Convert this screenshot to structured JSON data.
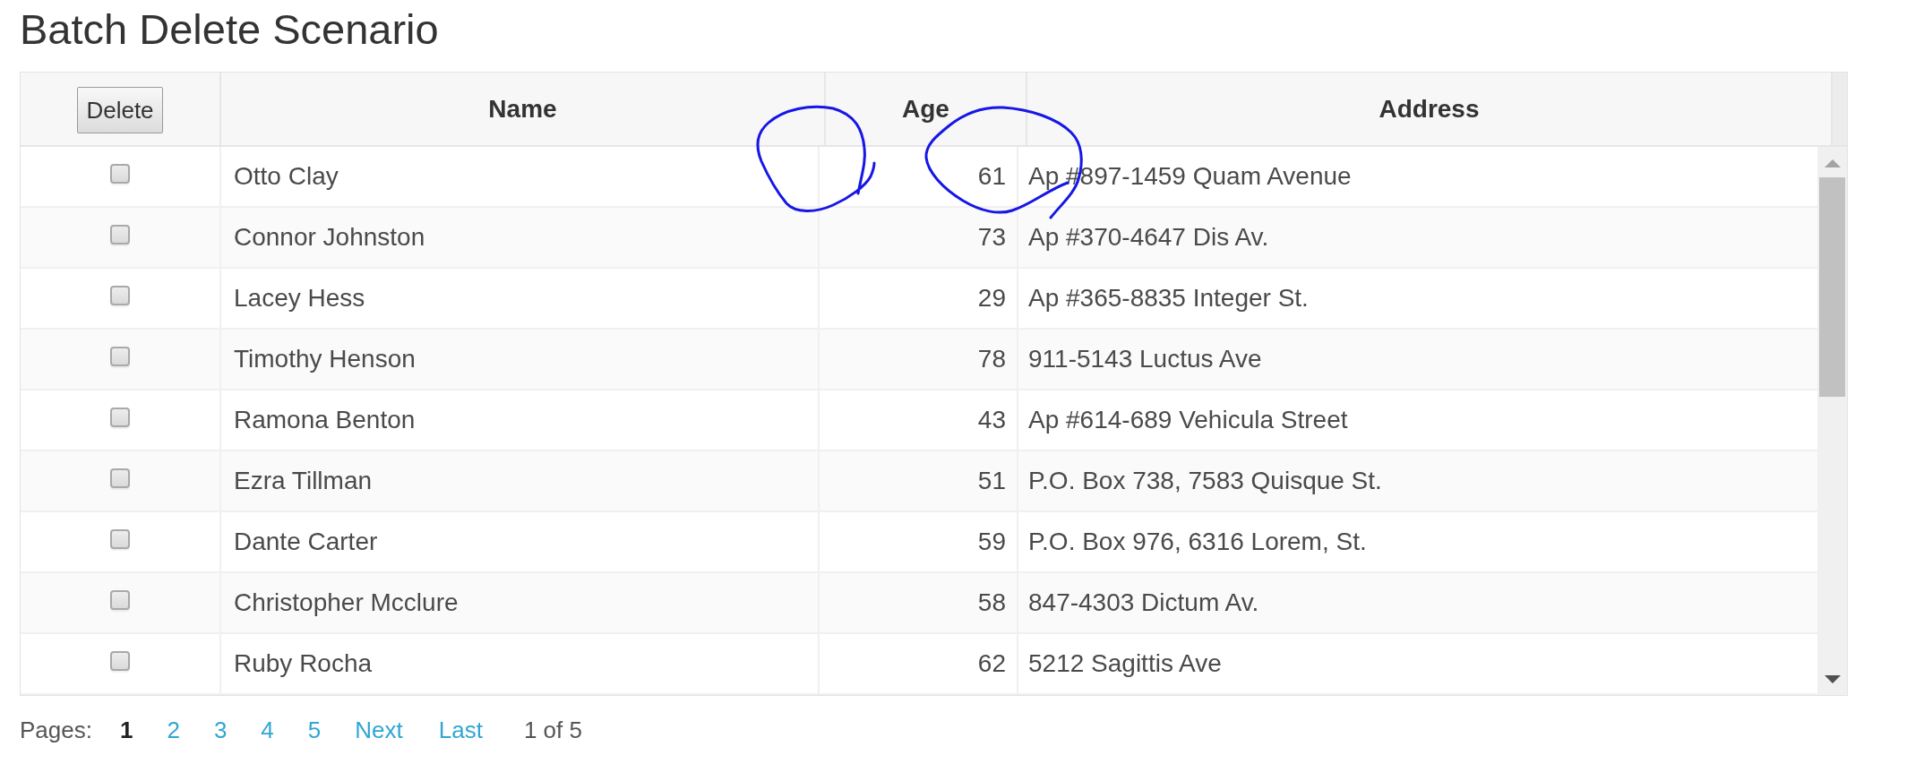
{
  "title": "Batch Delete Scenario",
  "table": {
    "delete_button": "Delete",
    "columns": [
      "Name",
      "Age",
      "Address"
    ],
    "rows": [
      {
        "checked": false,
        "name": "Otto Clay",
        "age": "61",
        "address": "Ap #897-1459 Quam Avenue"
      },
      {
        "checked": false,
        "name": "Connor Johnston",
        "age": "73",
        "address": "Ap #370-4647 Dis Av."
      },
      {
        "checked": false,
        "name": "Lacey Hess",
        "age": "29",
        "address": "Ap #365-8835 Integer St."
      },
      {
        "checked": false,
        "name": "Timothy Henson",
        "age": "78",
        "address": "911-5143 Luctus Ave"
      },
      {
        "checked": false,
        "name": "Ramona Benton",
        "age": "43",
        "address": "Ap #614-689 Vehicula Street"
      },
      {
        "checked": false,
        "name": "Ezra Tillman",
        "age": "51",
        "address": "P.O. Box 738, 7583 Quisque St."
      },
      {
        "checked": false,
        "name": "Dante Carter",
        "age": "59",
        "address": "P.O. Box 976, 6316 Lorem, St."
      },
      {
        "checked": false,
        "name": "Christopher Mcclure",
        "age": "58",
        "address": "847-4303 Dictum Av."
      },
      {
        "checked": false,
        "name": "Ruby Rocha",
        "age": "62",
        "address": "5212 Sagittis Ave"
      }
    ]
  },
  "pagination": {
    "label": "Pages:",
    "pages": [
      {
        "label": "1",
        "selected": true
      },
      {
        "label": "2",
        "selected": false
      },
      {
        "label": "3",
        "selected": false
      },
      {
        "label": "4",
        "selected": false
      },
      {
        "label": "5",
        "selected": false
      }
    ],
    "next": "Next",
    "last": "Last",
    "summary": "1 of 5"
  }
}
